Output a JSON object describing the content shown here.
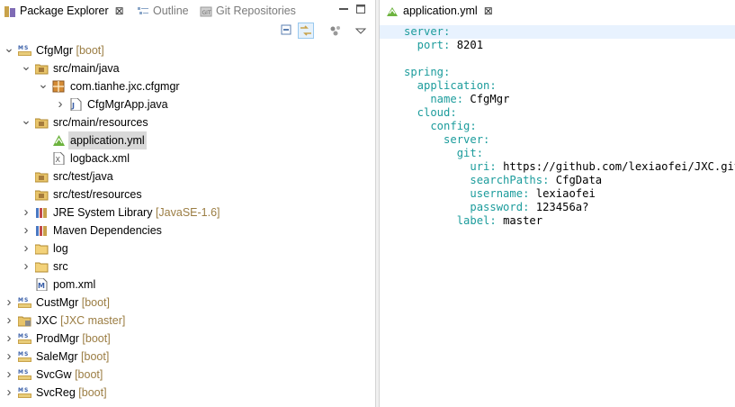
{
  "left_panel": {
    "tabs": [
      {
        "label": "Package Explorer",
        "close": "⊠"
      },
      {
        "label": "Outline"
      },
      {
        "label": "Git Repositories"
      }
    ]
  },
  "tree": {
    "items": [
      {
        "label": "CfgMgr",
        "deco": "[boot]"
      },
      {
        "label": "src/main/java"
      },
      {
        "label": "com.tianhe.jxc.cfgmgr"
      },
      {
        "label": "CfgMgrApp.java"
      },
      {
        "label": "src/main/resources"
      },
      {
        "label": "application.yml"
      },
      {
        "label": "logback.xml"
      },
      {
        "label": "src/test/java"
      },
      {
        "label": "src/test/resources"
      },
      {
        "label": "JRE System Library",
        "deco": "[JavaSE-1.6]"
      },
      {
        "label": "Maven Dependencies"
      },
      {
        "label": "log"
      },
      {
        "label": "src"
      },
      {
        "label": "pom.xml"
      },
      {
        "label": "CustMgr",
        "deco": "[boot]"
      },
      {
        "label": "JXC",
        "deco": "[JXC master]"
      },
      {
        "label": "ProdMgr",
        "deco": "[boot]"
      },
      {
        "label": "SaleMgr",
        "deco": "[boot]"
      },
      {
        "label": "SvcGw",
        "deco": "[boot]"
      },
      {
        "label": "SvcReg",
        "deco": "[boot]"
      }
    ]
  },
  "editor": {
    "tab": {
      "label": "application.yml",
      "close": "⊠"
    },
    "lines": [
      {
        "k": "server:",
        "v": ""
      },
      {
        "k": "  port:",
        "v": " 8201"
      },
      {
        "k": "",
        "v": ""
      },
      {
        "k": "spring:",
        "v": ""
      },
      {
        "k": "  application:",
        "v": ""
      },
      {
        "k": "    name:",
        "v": " CfgMgr"
      },
      {
        "k": "  cloud:",
        "v": ""
      },
      {
        "k": "    config:",
        "v": ""
      },
      {
        "k": "      server:",
        "v": ""
      },
      {
        "k": "        git:",
        "v": ""
      },
      {
        "k": "          uri:",
        "v": " https://github.com/lexiaofei/JXC.git"
      },
      {
        "k": "          searchPaths:",
        "v": " CfgData"
      },
      {
        "k": "          username:",
        "v": " lexiaofei"
      },
      {
        "k": "          password:",
        "v": " 123456a?"
      },
      {
        "k": "        label:",
        "v": " master"
      }
    ]
  }
}
